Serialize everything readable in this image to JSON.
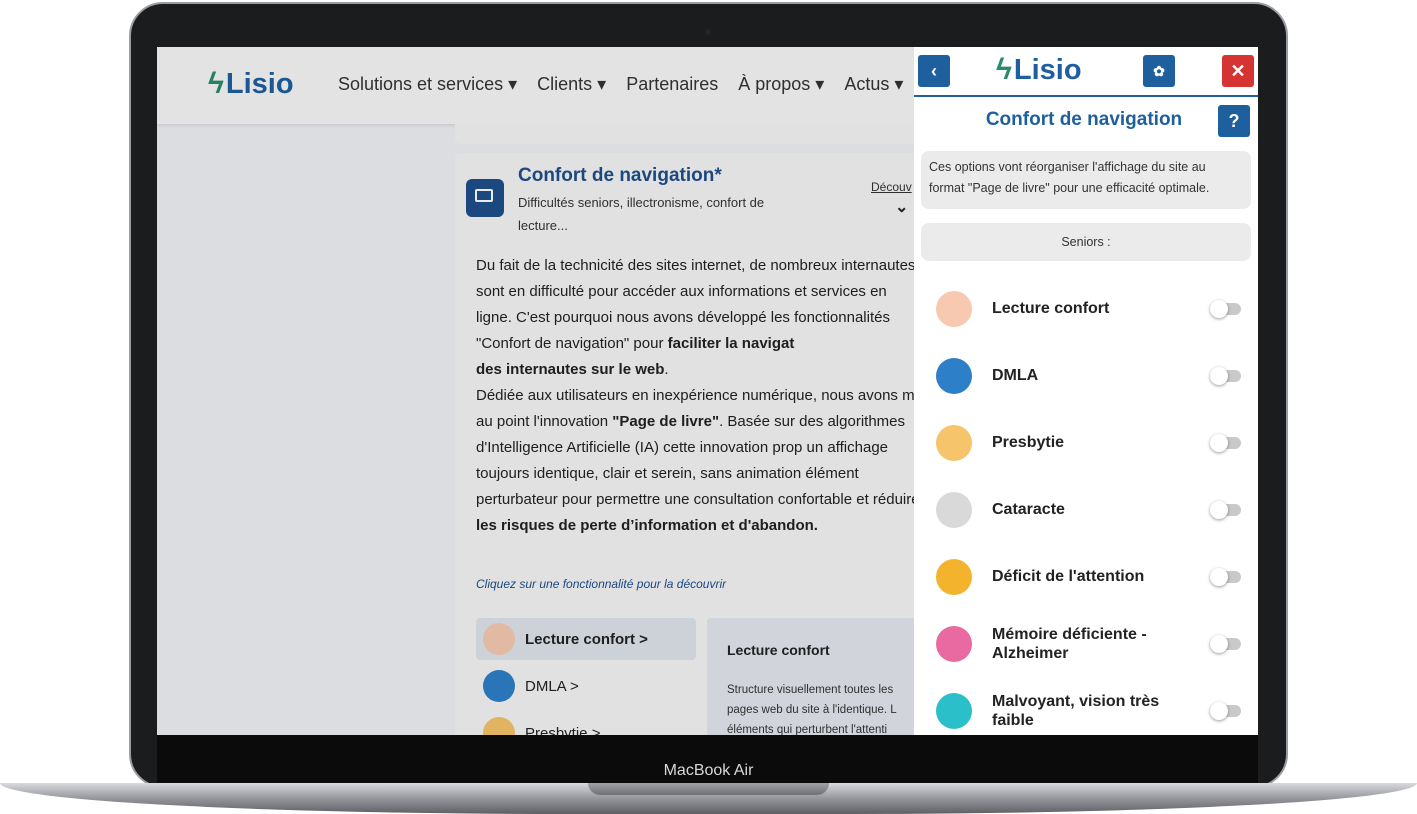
{
  "device": {
    "brand_label": "MacBook Air"
  },
  "site": {
    "logo_text": "Lisio",
    "nav": [
      "Solutions et services ▾",
      "Clients ▾",
      "Partenaires",
      "À propos ▾",
      "Actus ▾"
    ],
    "card": {
      "title": "Confort de navigation*",
      "subtitle": "Difficultés seniors, illectronisme, confort de lecture...",
      "more_link": "Découv",
      "body_parts": [
        "Du fait de la technicité des sites internet, de nombreux internautes sont en difficulté pour accéder aux informations et services en ligne. C'est pourquoi nous avons développé les fonctionnalités \"Confort de navigation\" pour ",
        "faciliter la navigat",
        "des internautes sur le web",
        ".",
        "Dédiée aux utilisateurs en inexpérience numérique, nous avons mis au point l'innovation ",
        "\"Page de livre\"",
        ". Basée sur des algorithmes d'Intelligence Artificielle (IA) cette innovation prop un affichage toujours identique, clair et serein, sans animation élément perturbateur pour permettre une consultation confortable et réduire ",
        "les risques de perte d’information et d'abandon."
      ],
      "hint": "Cliquez sur une fonctionnalité pour la découvrir",
      "features": [
        "Lecture confort >",
        "DMLA >",
        "Presbytie >"
      ],
      "description": {
        "title": "Lecture confort",
        "text": "Structure visuellement toutes les pages web du site à l'identique. L éléments qui perturbent l'attenti"
      }
    }
  },
  "panel": {
    "logo_text": "Lisio",
    "back_icon": "‹",
    "settings_icon": "✿",
    "close_icon": "✕",
    "title": "Confort de navigation",
    "help_label": "?",
    "info": "Ces options vont réorganiser l'affichage du site au format \"Page de livre\" pour une efficacité optimale.",
    "section": "Seniors :",
    "items": [
      {
        "label": "Lecture confort",
        "icon": "book-icon",
        "color": "#f6c9b0",
        "enabled": false
      },
      {
        "label": "DMLA",
        "icon": "magnifier-plus-icon",
        "color": "#2d7fc8",
        "enabled": false
      },
      {
        "label": "Presbytie",
        "icon": "magnifier-eye-icon",
        "color": "#f5c46b",
        "enabled": false
      },
      {
        "label": "Cataracte",
        "icon": "eye-icon",
        "color": "#d9d9d9",
        "enabled": false
      },
      {
        "label": "Déficit de l'attention",
        "icon": "woman-icon",
        "color": "#f4b32c",
        "enabled": false
      },
      {
        "label": "Mémoire déficiente - Alzheimer",
        "icon": "elderly-woman-icon",
        "color": "#e86aa0",
        "enabled": false
      },
      {
        "label": "Malvoyant, vision très faible",
        "icon": "eye-slash-icon",
        "color": "#2bbfc9",
        "enabled": false
      }
    ]
  }
}
